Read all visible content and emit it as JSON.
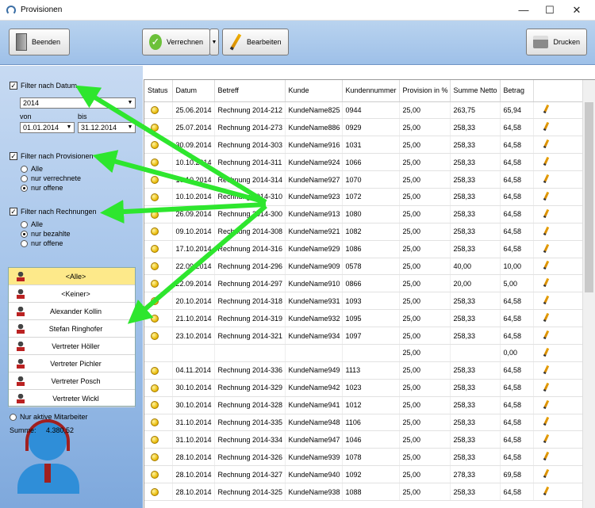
{
  "window": {
    "title": "Provisionen",
    "minimize": "—",
    "maximize": "☐",
    "close": "✕"
  },
  "toolbar": {
    "beenden": "Beenden",
    "verrechnen": "Verrechnen",
    "bearbeiten": "Bearbeiten",
    "drucken": "Drucken"
  },
  "filters": {
    "datum_label": "Filter nach Datum",
    "year": "2014",
    "von_label": "von",
    "bis_label": "bis",
    "von": "01.01.2014",
    "bis": "31.12.2014",
    "provisionen_label": "Filter nach Provisionen",
    "provisionen_options": [
      "Alle",
      "nur verrechnete",
      "nur offene"
    ],
    "rechnungen_label": "Filter nach Rechnungen",
    "rechnungen_options": [
      "Alle",
      "nur bezahlte",
      "nur offene"
    ]
  },
  "persons": [
    "<Alle>",
    "<Keiner>",
    "Alexander Kollin",
    "Stefan Ringhofer",
    "Vertreter Höller",
    "Vertreter Pichler",
    "Vertreter Posch",
    "Vertreter Wickl"
  ],
  "nur_aktive_label": "Nur aktive Mitarbeiter",
  "summe_label": "Summe:",
  "summe_value": "4.380,52",
  "table": {
    "headers": [
      "Status",
      "Datum",
      "Betreff",
      "Kunde",
      "Kundennummer",
      "Provision in %",
      "Summe Netto",
      "Betrag"
    ],
    "rows": [
      [
        "25.06.2014",
        "Rechnung 2014-212",
        "KundeName825",
        "0944",
        "25,00",
        "263,75",
        "65,94"
      ],
      [
        "25.07.2014",
        "Rechnung 2014-273",
        "KundeName886",
        "0929",
        "25,00",
        "258,33",
        "64,58"
      ],
      [
        "30.09.2014",
        "Rechnung 2014-303",
        "KundeName916",
        "1031",
        "25,00",
        "258,33",
        "64,58"
      ],
      [
        "10.10.2014",
        "Rechnung 2014-311",
        "KundeName924",
        "1066",
        "25,00",
        "258,33",
        "64,58"
      ],
      [
        "10.10.2014",
        "Rechnung 2014-314",
        "KundeName927",
        "1070",
        "25,00",
        "258,33",
        "64,58"
      ],
      [
        "10.10.2014",
        "Rechnung 2014-310",
        "KundeName923",
        "1072",
        "25,00",
        "258,33",
        "64,58"
      ],
      [
        "26.09.2014",
        "Rechnung 2014-300",
        "KundeName913",
        "1080",
        "25,00",
        "258,33",
        "64,58"
      ],
      [
        "09.10.2014",
        "Rechnung 2014-308",
        "KundeName921",
        "1082",
        "25,00",
        "258,33",
        "64,58"
      ],
      [
        "17.10.2014",
        "Rechnung 2014-316",
        "KundeName929",
        "1086",
        "25,00",
        "258,33",
        "64,58"
      ],
      [
        "22.09.2014",
        "Rechnung 2014-296",
        "KundeName909",
        "0578",
        "25,00",
        "40,00",
        "10,00"
      ],
      [
        "22.09.2014",
        "Rechnung 2014-297",
        "KundeName910",
        "0866",
        "25,00",
        "20,00",
        "5,00"
      ],
      [
        "20.10.2014",
        "Rechnung 2014-318",
        "KundeName931",
        "1093",
        "25,00",
        "258,33",
        "64,58"
      ],
      [
        "21.10.2014",
        "Rechnung 2014-319",
        "KundeName932",
        "1095",
        "25,00",
        "258,33",
        "64,58"
      ],
      [
        "23.10.2014",
        "Rechnung 2014-321",
        "KundeName934",
        "1097",
        "25,00",
        "258,33",
        "64,58"
      ],
      [
        "",
        "",
        "",
        "",
        "25,00",
        "",
        "0,00"
      ],
      [
        "04.11.2014",
        "Rechnung 2014-336",
        "KundeName949",
        "1113",
        "25,00",
        "258,33",
        "64,58"
      ],
      [
        "30.10.2014",
        "Rechnung 2014-329",
        "KundeName942",
        "1023",
        "25,00",
        "258,33",
        "64,58"
      ],
      [
        "30.10.2014",
        "Rechnung 2014-328",
        "KundeName941",
        "1012",
        "25,00",
        "258,33",
        "64,58"
      ],
      [
        "31.10.2014",
        "Rechnung 2014-335",
        "KundeName948",
        "1106",
        "25,00",
        "258,33",
        "64,58"
      ],
      [
        "31.10.2014",
        "Rechnung 2014-334",
        "KundeName947",
        "1046",
        "25,00",
        "258,33",
        "64,58"
      ],
      [
        "28.10.2014",
        "Rechnung 2014-326",
        "KundeName939",
        "1078",
        "25,00",
        "258,33",
        "64,58"
      ],
      [
        "28.10.2014",
        "Rechnung 2014-327",
        "KundeName940",
        "1092",
        "25,00",
        "278,33",
        "69,58"
      ],
      [
        "28.10.2014",
        "Rechnung 2014-325",
        "KundeName938",
        "1088",
        "25,00",
        "258,33",
        "64,58"
      ]
    ],
    "empty_status_row": 14
  },
  "colors": {
    "arrow": "#2ee62e",
    "selected_row": "#fde98a"
  }
}
